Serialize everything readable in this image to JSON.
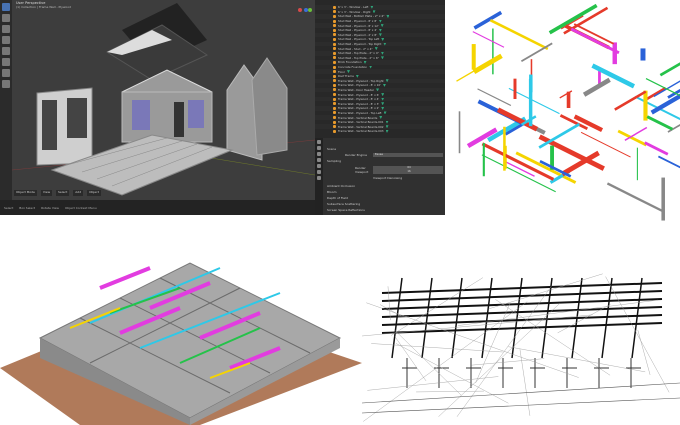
{
  "blender": {
    "viewport_title": "User Perspective",
    "viewport_subtitle": "(1) Collection | Frame Wall - Plywood",
    "header_menu": [
      "Object Mode",
      "View",
      "Select",
      "Add",
      "Object"
    ],
    "status_items": [
      "Select",
      "Box Select",
      "Rotate View",
      "Object Context Menu"
    ],
    "outliner_items": [
      "6' x 3' - Window - Left",
      "6' x 3' - Window - Right",
      "Stud Wall - Bottom Plate - 2\" x 4\"",
      "Stud Wall - Plywood - 8' x 8'",
      "Stud Wall - Plywood - 8' x 12'",
      "Stud Wall - Plywood - 8' x 4'",
      "Stud Wall - Plywood - 2' x 8'",
      "Stud Wall - Plywood - Top Left",
      "Stud Wall - Plywood - Top Right",
      "Stud Wall - Stud - 2\" x 4\"",
      "Stud Wall - Top Plate - 2\" x 4\"",
      "Stud Wall - Top Plate - 2\" x 6\"",
      "Brick Foundation",
      "Concrete Foundation",
      "Floor",
      "Roof Frame",
      "Frame Wall - Plywood - Top Right",
      "Frame Wall - Plywood - 8' x 10'",
      "Frame Wall - Door Header",
      "Frame Wall - Plywood - 8' x 6'",
      "Frame Wall - Plywood - 8' x 4'",
      "Frame Wall - Plywood - 8' x 3'",
      "Frame Wall - Plywood - 8' x 2'",
      "Frame Wall - Plywood - Top Left",
      "Frame Wall - Vertical Boards",
      "Frame Wall - Vertical Boards.001",
      "Frame Wall - Vertical Boards.002",
      "Frame Wall - Vertical Boards.003"
    ],
    "properties": {
      "scene_label": "Scene",
      "render_engine_label": "Render Engine",
      "render_engine_value": "Eevee",
      "sampling_label": "Sampling",
      "render_label": "Render",
      "render_value": "64",
      "viewport_label": "Viewport",
      "viewport_value": "16",
      "denoise_label": "Viewport Denoising",
      "sections": [
        "Ambient Occlusion",
        "Bloom",
        "Depth of Field",
        "Subsurface Scattering",
        "Screen Space Reflections"
      ]
    }
  },
  "colors": {
    "blender_bg": "#3d3d3d",
    "accent": "#4772b3",
    "pipe_red": "#e53a2a",
    "pipe_yellow": "#f5d400",
    "pipe_blue": "#2a62d8",
    "duct_magenta": "#e23ce0",
    "pipe_green": "#25c24a",
    "pipe_cyan": "#2ec9e8"
  }
}
